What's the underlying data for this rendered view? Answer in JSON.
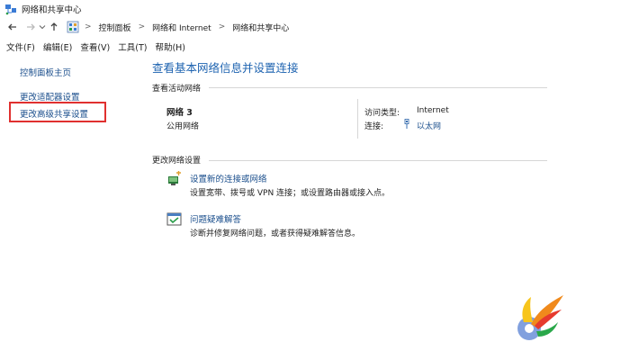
{
  "window": {
    "title": "网络和共享中心"
  },
  "address": {
    "crumbs": [
      "控制面板",
      "网络和 Internet",
      "网络和共享中心"
    ],
    "separator": ">"
  },
  "menu": [
    "文件(F)",
    "编辑(E)",
    "查看(V)",
    "工具(T)",
    "帮助(H)"
  ],
  "sidebar": {
    "items": [
      {
        "label": "控制面板主页"
      },
      {
        "label": "更改适配器设置"
      },
      {
        "label": "更改高级共享设置"
      }
    ]
  },
  "main": {
    "heading": "查看基本网络信息并设置连接",
    "active": {
      "title": "查看活动网络",
      "network_name": "网络  3",
      "network_type": "公用网络",
      "access_label": "访问类型:",
      "access_value": "Internet",
      "connection_label": "连接:",
      "connection_value": "以太网"
    },
    "change": {
      "title": "更改网络设置",
      "tasks": [
        {
          "link": "设置新的连接或网络",
          "desc": "设置宽带、拨号或 VPN 连接；或设置路由器或接入点。"
        },
        {
          "link": "问题疑难解答",
          "desc": "诊断并修复网络问题，或者获得疑难解答信息。"
        }
      ]
    }
  },
  "colors": {
    "link": "#1a4e8c",
    "heading": "#1e63b0",
    "highlight": "#e0302f"
  }
}
